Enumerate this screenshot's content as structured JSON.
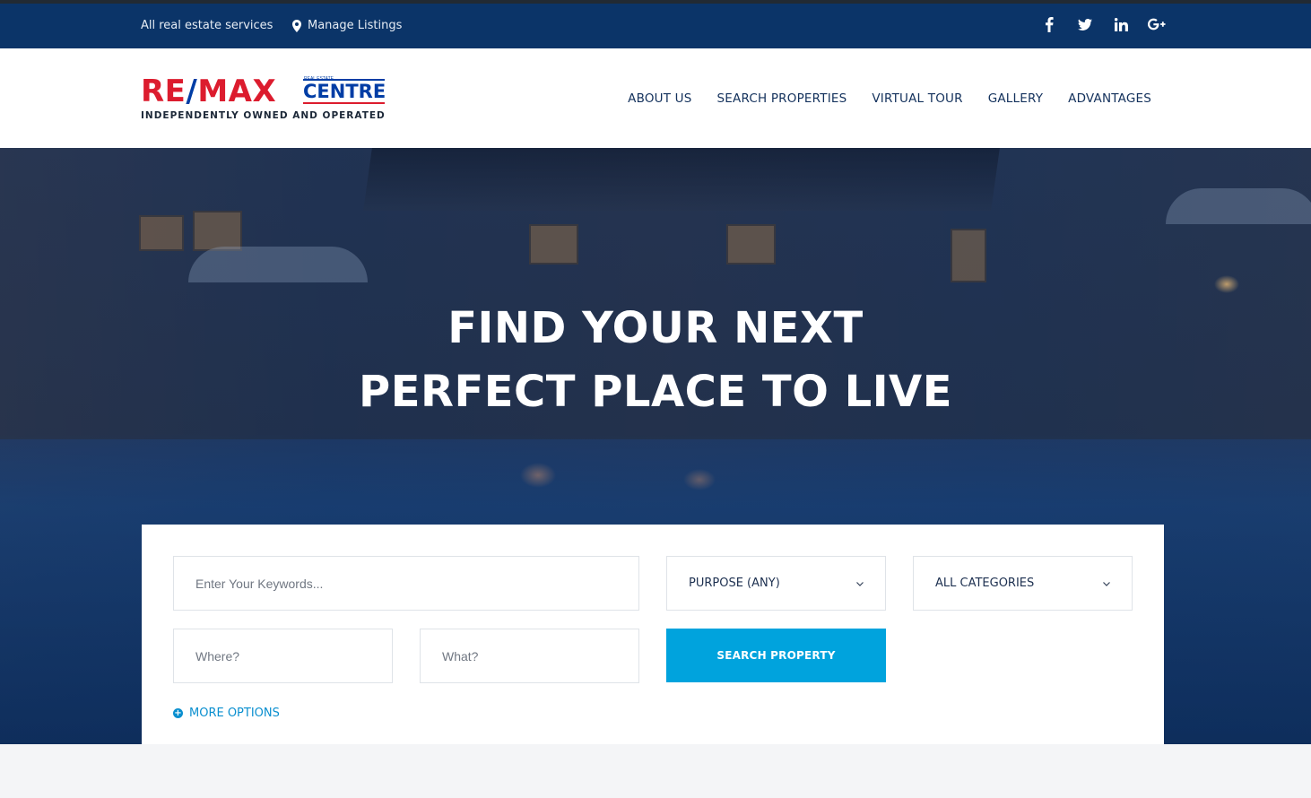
{
  "topbar": {
    "services_label": "All real estate services",
    "manage_label": "Manage Listings",
    "social": [
      {
        "icon": "facebook-icon",
        "glyph": "f"
      },
      {
        "icon": "twitter-icon",
        "glyph": "t"
      },
      {
        "icon": "linkedin-icon",
        "glyph": "in"
      },
      {
        "icon": "google-plus-icon",
        "glyph": "G+"
      }
    ]
  },
  "logo": {
    "brand_left": "RE",
    "brand_slash": "/",
    "brand_right": "MAX",
    "small": "REAL ESTATE",
    "centre": "CENTRE",
    "tagline": "INDEPENDENTLY OWNED AND OPERATED"
  },
  "nav": {
    "items": [
      "ABOUT US",
      "SEARCH PROPERTIES",
      "VIRTUAL TOUR",
      "GALLERY",
      "ADVANTAGES"
    ]
  },
  "hero": {
    "title_line1": "FIND YOUR NEXT",
    "title_line2": "PERFECT PLACE TO LIVE"
  },
  "search": {
    "keywords_placeholder": "Enter Your Keywords...",
    "purpose_value": "PURPOSE (ANY)",
    "category_value": "ALL CATEGORIES",
    "where_placeholder": "Where?",
    "what_placeholder": "What?",
    "button_label": "SEARCH PROPERTY",
    "more_options_label": "MORE OPTIONS"
  },
  "colors": {
    "topbar": "#0b3468",
    "accent": "#00a3dd",
    "nav_text": "#13315c",
    "brand_red": "#dc1c2e",
    "brand_blue": "#003da5"
  }
}
